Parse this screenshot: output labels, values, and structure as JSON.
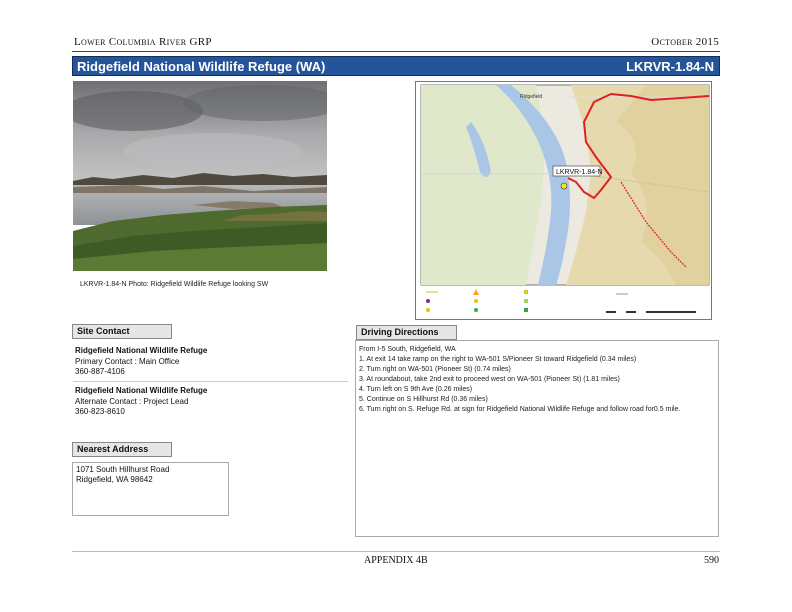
{
  "header": {
    "org": "Lower Columbia River GRP",
    "date": "October 2015"
  },
  "title_bar": {
    "site_name": "Ridgefield National Wildlife Refuge (WA)",
    "site_code": "LKRVR-1.84-N"
  },
  "photo": {
    "caption": "LKRVR-1.84-N Photo: Ridgefield Wildlife Refuge looking SW"
  },
  "map": {
    "town_label": "Ridgefield",
    "site_label": "LKRVR-1.84-N"
  },
  "site_contact": {
    "label": "Site Contact",
    "contacts": [
      {
        "name": "Ridgefield National Wildlife Refuge",
        "role": "Primary Contact : Main Office",
        "phone": "360-887-4106"
      },
      {
        "name": "Ridgefield National Wildlife Refuge",
        "role": "Alternate Contact : Project Lead",
        "phone": "360-823-8610"
      }
    ]
  },
  "nearest_address": {
    "label": "Nearest Address",
    "line1": "1071 South Hillhurst Road",
    "line2": "Ridgefield, WA  98642"
  },
  "driving_directions": {
    "label": "Driving Directions",
    "intro": "From I-5 South, Ridgefield, WA",
    "steps": [
      "1. At exit 14 take ramp on the right to WA-501 S/Pioneer St toward Ridgefield (0.34 miles)",
      "2. Turn right on WA-501 (Pioneer St) (0.74 miles)",
      "3. At roundabout, take 2nd exit to proceed west on WA-501 (Pioneer St) (1.81 miles)",
      "4. Turn left on S 9th Ave (0.26 miles)",
      "5. Continue on S Hillhurst Rd (0.36 miles)",
      "6. Turn right on S. Refuge Rd. at sign for Ridgefield National Wildlife Refuge and follow road for0.5 mile."
    ]
  },
  "footer": {
    "appendix": "APPENDIX 4B",
    "page": "590"
  }
}
